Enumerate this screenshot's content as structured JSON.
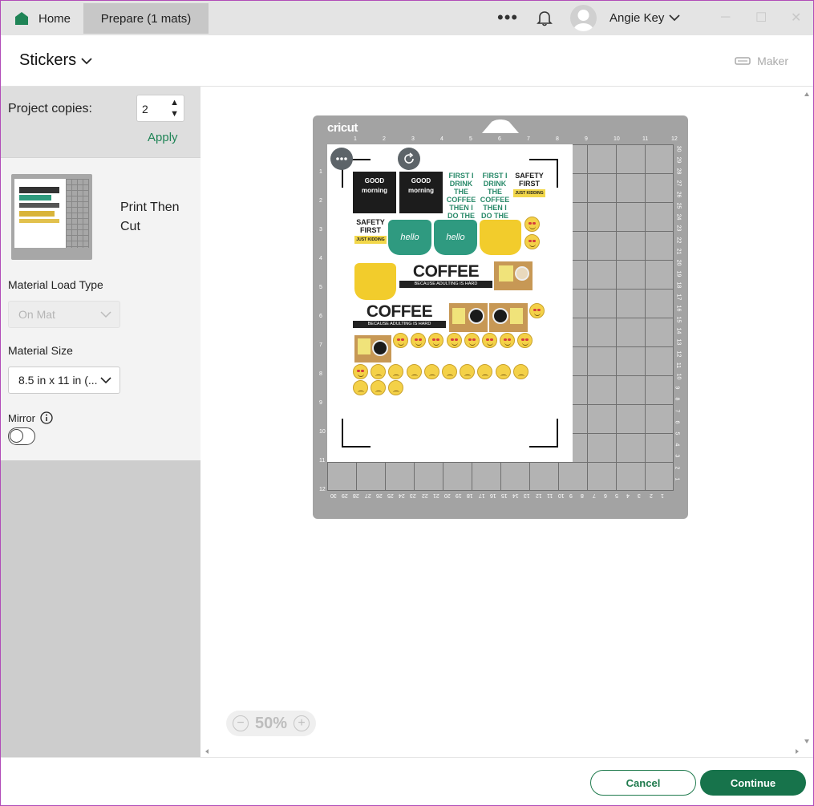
{
  "titlebar": {
    "home_label": "Home",
    "prepare_tab_label": "Prepare (1 mats)",
    "more_label": "•••",
    "user_name": "Angie Key",
    "window_controls": [
      "─",
      "☐",
      "✕"
    ]
  },
  "header": {
    "project_title": "Stickers",
    "machine_label": "Maker"
  },
  "sidebar": {
    "copies_label": "Project copies:",
    "copies_value": "2",
    "apply_label": "Apply",
    "mat_mode_label": "Print Then Cut",
    "load_type_label": "Material Load Type",
    "load_type_value": "On Mat",
    "size_label": "Material Size",
    "size_value": "8.5 in x 11 in (...",
    "mirror_label": "Mirror",
    "mirror_on": false
  },
  "mat": {
    "brand": "cricut",
    "top_ticks": [
      "1",
      "2",
      "3",
      "4",
      "5",
      "6",
      "7",
      "8",
      "9",
      "10",
      "11",
      "12"
    ],
    "left_ticks": [
      "1",
      "2",
      "3",
      "4",
      "5",
      "6",
      "7",
      "8",
      "9",
      "10",
      "11",
      "12"
    ],
    "bottom_ticks": [
      "30",
      "29",
      "28",
      "27",
      "26",
      "25",
      "24",
      "23",
      "22",
      "21",
      "20",
      "19",
      "18",
      "17",
      "16",
      "15",
      "14",
      "13",
      "12",
      "11",
      "10",
      "9",
      "8",
      "7",
      "6",
      "5",
      "4",
      "3",
      "2",
      "1"
    ],
    "right_ticks": [
      "30",
      "29",
      "28",
      "27",
      "26",
      "25",
      "24",
      "23",
      "22",
      "21",
      "20",
      "19",
      "18",
      "17",
      "16",
      "15",
      "14",
      "13",
      "12",
      "11",
      "10",
      "9",
      "8",
      "7",
      "6",
      "5",
      "4",
      "3",
      "2",
      "1"
    ]
  },
  "stickers": {
    "good_morning": "GOOD morning",
    "first_coffee": "FIRST I DRINK THE COFFEE THEN I DO THE THINGS",
    "safety_first": "SAFETY FIRST",
    "safety_sub": "JUST KIDDING",
    "hello": "hello",
    "coffee_word": "COFFEE",
    "coffee_sub": "BECAUSE ADULTING IS HARD"
  },
  "zoom": {
    "value": "50%",
    "minus": "−",
    "plus": "+"
  },
  "footer": {
    "cancel_label": "Cancel",
    "continue_label": "Continue"
  },
  "colors": {
    "accent": "#17734b",
    "mat": "#a3a3a3"
  }
}
